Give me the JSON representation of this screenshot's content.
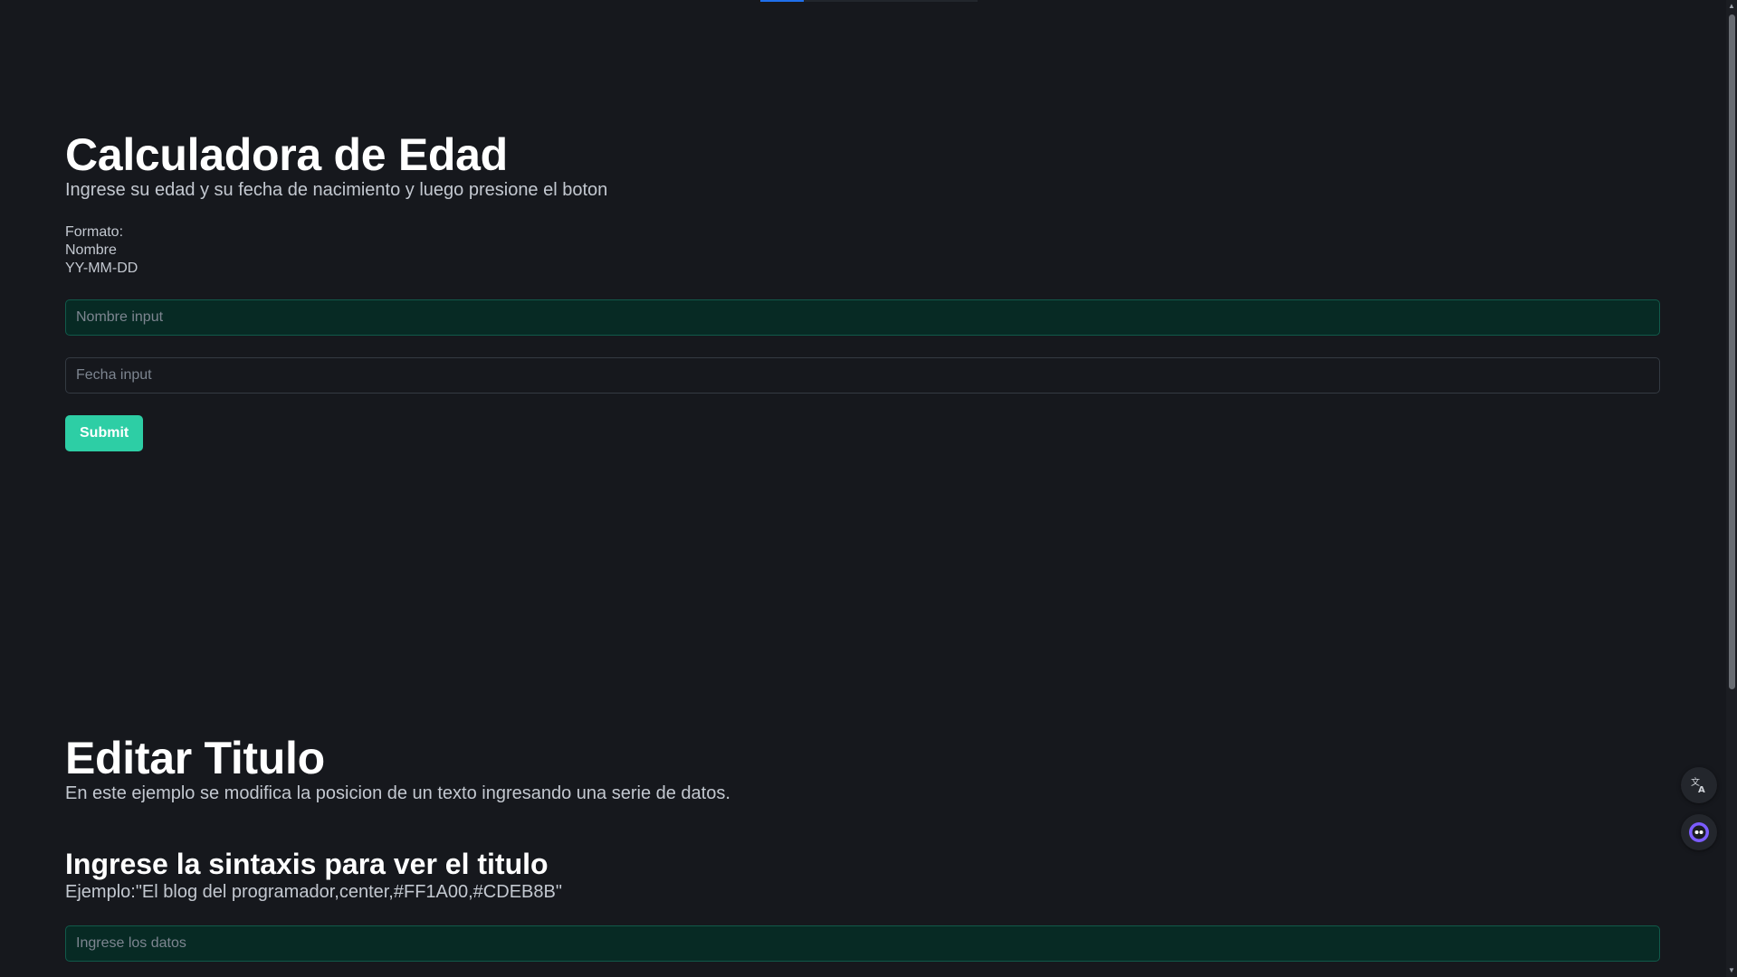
{
  "colors": {
    "background": "#16181d",
    "accent": "#2dcea5",
    "input_green_bg": "#072a24",
    "heading": "#ffffff",
    "text": "#c3c8d0"
  },
  "age_calculator": {
    "title": "Calculadora de Edad",
    "subtitle": "Ingrese su edad y su fecha de nacimiento y luego presione el boton",
    "format_lines": [
      "Formato:",
      "Nombre",
      "YY-MM-DD"
    ],
    "name_input": {
      "placeholder": "Nombre input",
      "value": ""
    },
    "date_input": {
      "placeholder": "Fecha input",
      "value": ""
    },
    "submit_label": "Submit"
  },
  "edit_title": {
    "title": "Editar Titulo",
    "subtitle": "En este ejemplo se modifica la posicion de un texto ingresando una serie de datos.",
    "section_heading": "Ingrese la sintaxis para ver el titulo",
    "example": "Ejemplo:\"El blog del programador,center,#FF1A00,#CDEB8B\"",
    "data_input": {
      "placeholder": "Ingrese los datos",
      "value": ""
    }
  },
  "floating_buttons": {
    "translate": {
      "icon": "translate-icon"
    },
    "assistant": {
      "icon": "assistant-icon"
    }
  },
  "scrollbar": {
    "up_arrow": "▲",
    "down_arrow": "▼"
  }
}
